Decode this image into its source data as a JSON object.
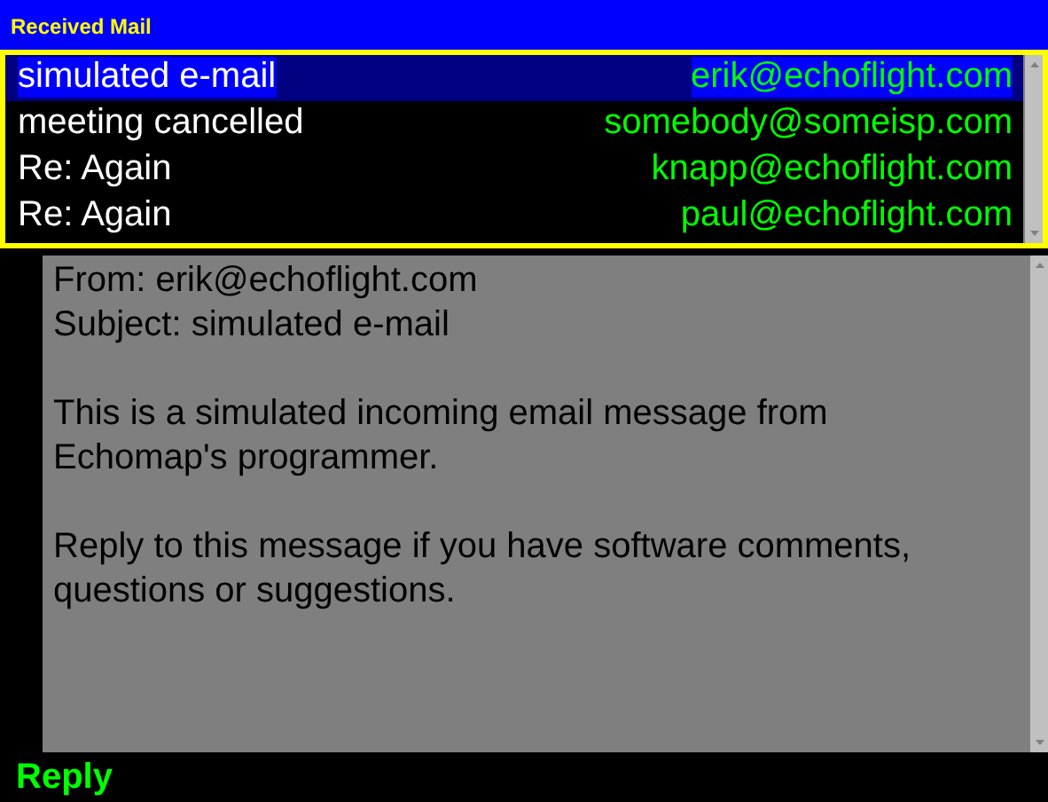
{
  "window": {
    "title": "Received Mail"
  },
  "messages": [
    {
      "subject": "simulated e-mail",
      "sender": "erik@echoflight.com",
      "selected": true
    },
    {
      "subject": "meeting cancelled",
      "sender": "somebody@someisp.com",
      "selected": false
    },
    {
      "subject": "Re: Again",
      "sender": "knapp@echoflight.com",
      "selected": false
    },
    {
      "subject": "Re: Again",
      "sender": "paul@echoflight.com",
      "selected": false
    }
  ],
  "message_view": {
    "headers": [
      "From: erik@echoflight.com",
      "Subject: simulated e-mail"
    ],
    "paragraphs": [
      "This is a simulated incoming email message from Echomap's programmer.",
      "Reply to this message if you have software comments, questions or suggestions."
    ]
  },
  "reply_button": "Reply"
}
